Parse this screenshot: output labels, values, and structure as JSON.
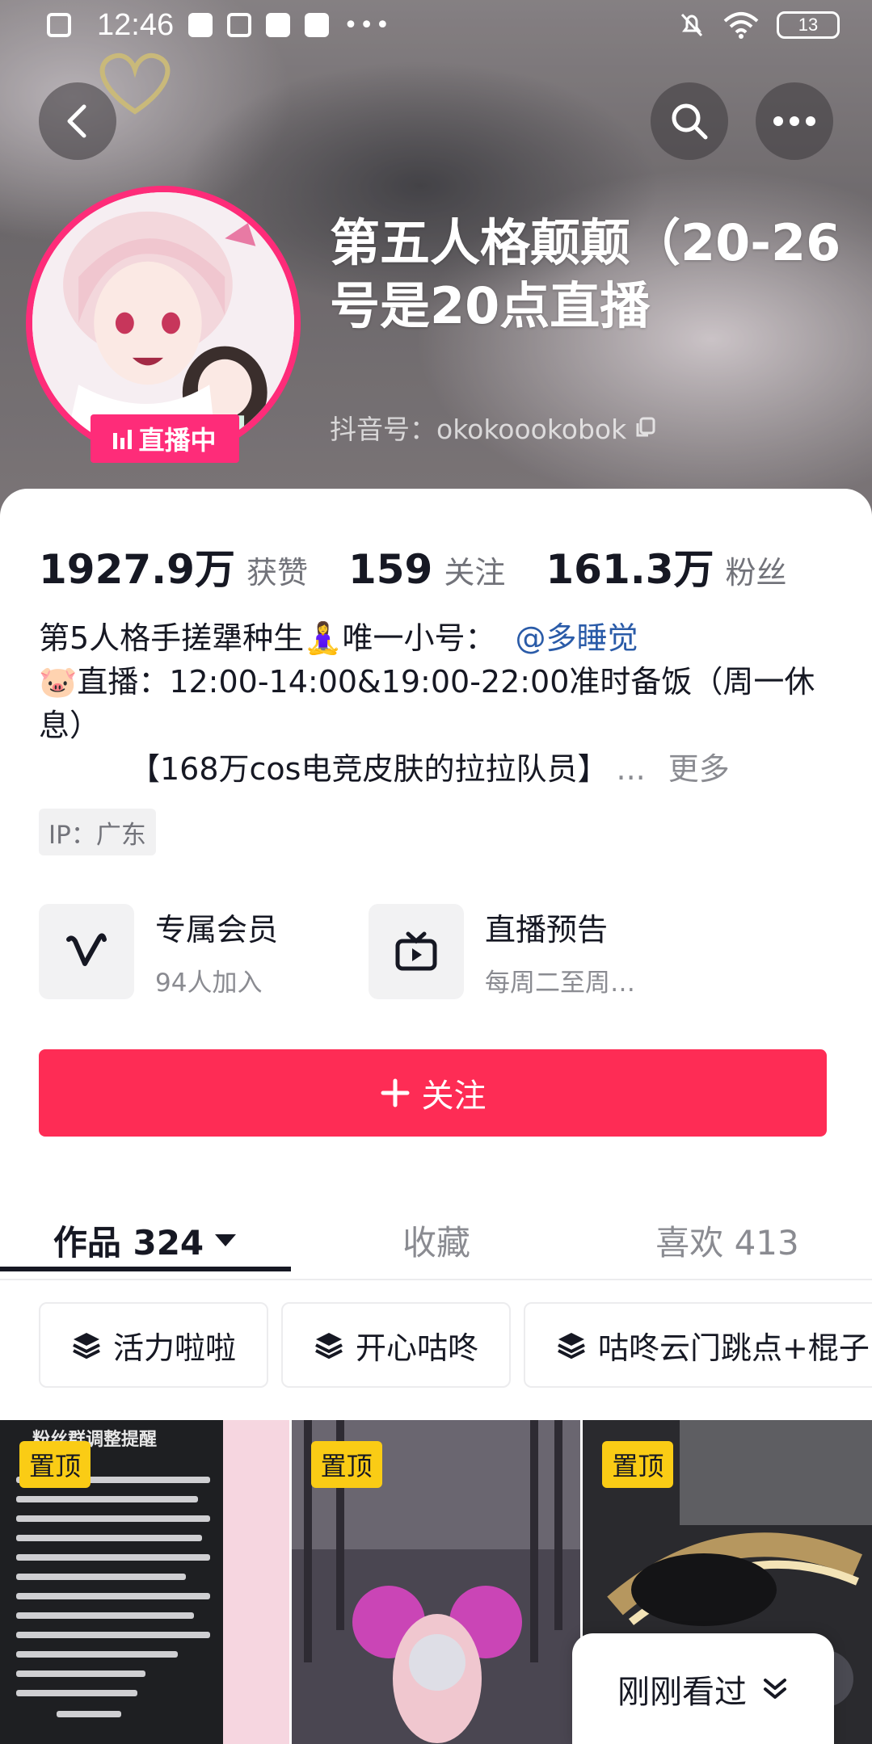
{
  "status_bar": {
    "time": "12:46",
    "battery": "13"
  },
  "profile": {
    "name": "第五人格颠颠（20-26号是20点直播",
    "douyin_id": "抖音号：okokoookobok",
    "live_badge": "直播中"
  },
  "stats": {
    "likes_value": "1927.9万",
    "likes_label": "获赞",
    "following_value": "159",
    "following_label": "关注",
    "followers_value": "161.3万",
    "followers_label": "粉丝"
  },
  "bio": {
    "line1": "第5人格手搓犟种生🧘‍♀️唯一小号：",
    "mention": "@多睡觉",
    "line2": "🐷直播：12:00-14:00&19:00-22:00准时备饭（周一休息）",
    "line3": "【168万cos电竞皮肤的拉拉队员】",
    "ellipsis": "...",
    "more": "更多"
  },
  "ip": "IP：广东",
  "features": [
    {
      "title": "专属会员",
      "subtitle": "94人加入",
      "icon": "v-membership-icon"
    },
    {
      "title": "直播预告",
      "subtitle": "每周二至周…",
      "icon": "tv-live-icon"
    }
  ],
  "follow_button": "关注",
  "tabs": [
    {
      "label": "作品 324"
    },
    {
      "label": "收藏"
    },
    {
      "label": "喜欢 413"
    }
  ],
  "collections": [
    {
      "label": "活力啦啦"
    },
    {
      "label": "开心咕咚"
    },
    {
      "label": "咕咚云门跳点+棍子"
    }
  ],
  "videos": [
    {
      "pinned": "置顶",
      "thumb_title": "粉丝群调整提醒"
    },
    {
      "pinned": "置顶"
    },
    {
      "pinned": "置顶"
    }
  ],
  "recently_viewed": "刚刚看过",
  "colors": {
    "accent": "#fe2c55",
    "live": "#fe2c79",
    "pin": "#facc15",
    "mention": "#2a5ba8"
  }
}
